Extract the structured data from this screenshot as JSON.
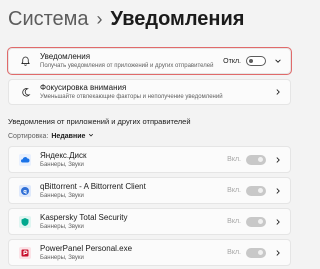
{
  "header": {
    "parent": "Система",
    "separator": "›",
    "current": "Уведомления"
  },
  "notifications_row": {
    "title": "Уведомления",
    "subtitle": "Получать уведомления от приложений и других отправителей",
    "state": "Откл."
  },
  "focus_row": {
    "title": "Фокусировка внимания",
    "subtitle": "Уменьшайте отвлекающие факторы и неполучение уведомлений"
  },
  "apps_section": {
    "heading": "Уведомления от приложений и других отправителей",
    "sort_label": "Сортировка:",
    "sort_value": "Недавние"
  },
  "apps": [
    {
      "name": "Яндекс.Диск",
      "subtitle": "Баннеры, Звуки",
      "state": "Вкл.",
      "icon": "yandex-disk-icon",
      "color": "#1a73e8"
    },
    {
      "name": "qBittorrent - A Bittorrent Client",
      "subtitle": "Баннеры, Звуки",
      "state": "Вкл.",
      "icon": "qbittorrent-icon",
      "color": "#2f6fd6"
    },
    {
      "name": "Kaspersky Total Security",
      "subtitle": "Баннеры, Звуки",
      "state": "Вкл.",
      "icon": "kaspersky-icon",
      "color": "#00a88e"
    },
    {
      "name": "PowerPanel Personal.exe",
      "subtitle": "Баннеры, Звуки",
      "state": "Вкл.",
      "icon": "powerpanel-icon",
      "color": "#c8102e"
    }
  ],
  "colors": {
    "highlight_border": "#e06a6a",
    "page_bg": "#f3f3f3",
    "card_bg": "#fbfbfb"
  }
}
